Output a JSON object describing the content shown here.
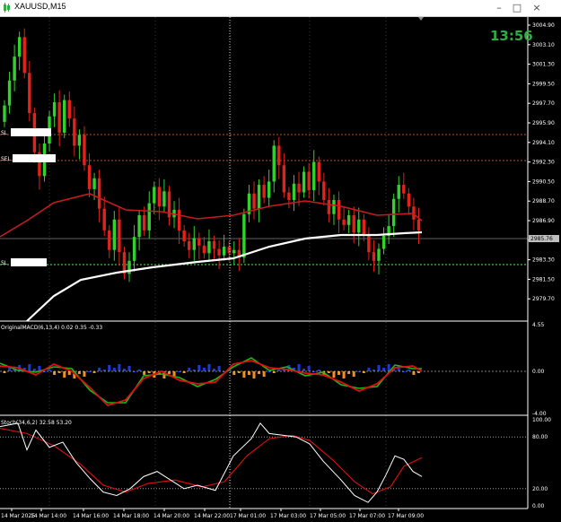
{
  "window": {
    "title": "XAUUSD,M15",
    "buttons": {
      "minimize": "–",
      "maximize": "□",
      "close": "×"
    }
  },
  "clock": "13:56",
  "current_price_label": "2985.76",
  "trade_labels": [
    "SL",
    "SEL",
    "SL"
  ],
  "colors": {
    "bull": "#33d12d",
    "bear": "#e2231a",
    "ma_red": "#c51d1d",
    "ma_white": "#ffffff",
    "grid_dot": "#3a3a3a",
    "level_orange": "#c1501a",
    "level_green": "#2ecc2e",
    "macd_blue": "#1e3bd0",
    "macd_orange": "#f09020",
    "macd_red": "#e01010",
    "macd_green": "#1cb81c"
  },
  "main_axis": {
    "ticks": [
      "3004.90",
      "3003.10",
      "3001.30",
      "2999.50",
      "2997.70",
      "2995.90",
      "2994.10",
      "2992.30",
      "2990.50",
      "2988.70",
      "2986.90",
      "2985.10",
      "2983.30",
      "2981.50",
      "2979.70"
    ]
  },
  "macd": {
    "label": "OriginalMACD(6,13,4) 0.02 0.35 -0.33",
    "ticks": [
      "4.55",
      "0.00",
      "-4.00"
    ]
  },
  "stoch": {
    "label": "Stoch(34,6,2) 32.58 53.20",
    "ticks": [
      "100.00",
      "80.00",
      "20.00",
      "0.00"
    ]
  },
  "time_axis": [
    "14 Mar 2025",
    "14 Mar 14:00",
    "14 Mar 16:00",
    "14 Mar 18:00",
    "14 Mar 20:00",
    "14 Mar 22:00",
    "17 Mar 01:00",
    "17 Mar 03:00",
    "17 Mar 05:00",
    "17 Mar 07:00",
    "17 Mar 09:00"
  ]
}
